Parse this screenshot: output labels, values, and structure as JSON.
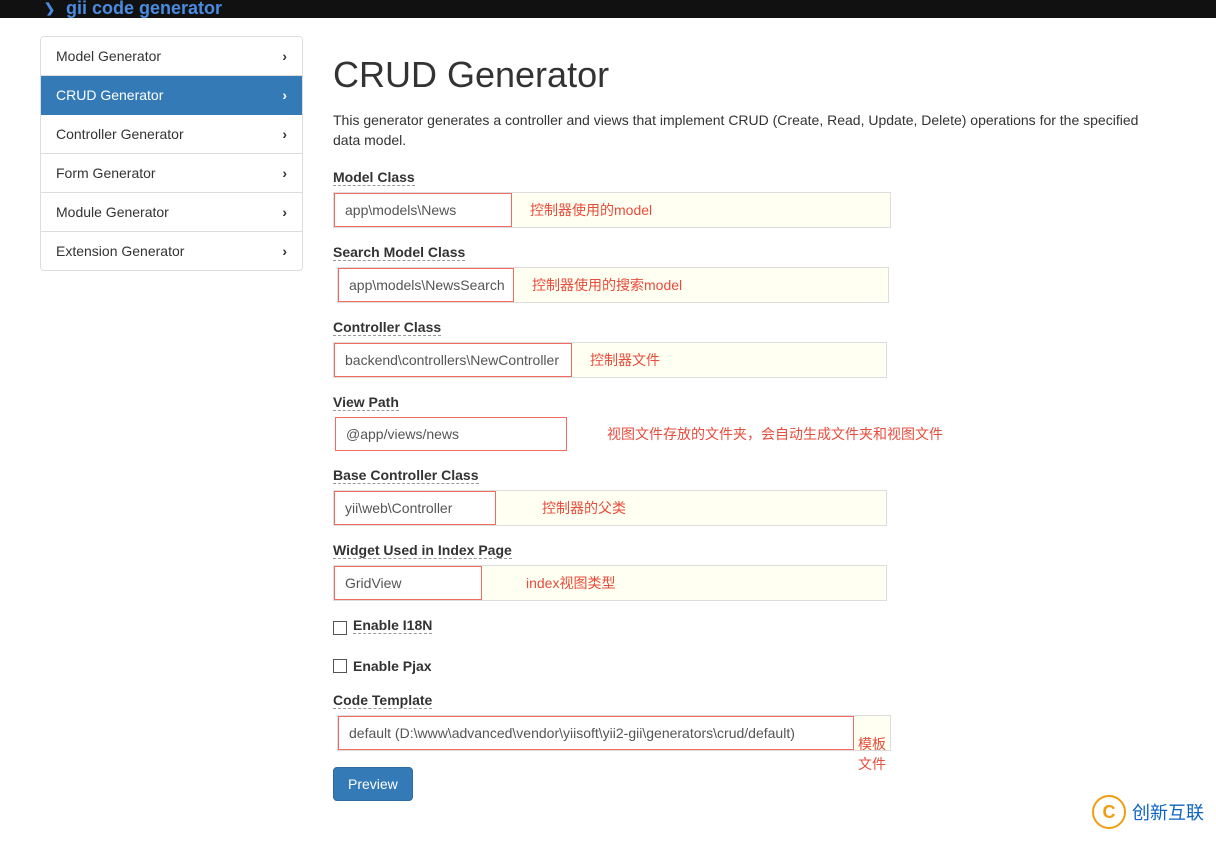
{
  "topbar": {
    "brand": "gii code generator"
  },
  "sidebar": {
    "items": [
      {
        "label": "Model Generator",
        "active": false
      },
      {
        "label": "CRUD Generator",
        "active": true
      },
      {
        "label": "Controller Generator",
        "active": false
      },
      {
        "label": "Form Generator",
        "active": false
      },
      {
        "label": "Module Generator",
        "active": false
      },
      {
        "label": "Extension Generator",
        "active": false
      }
    ]
  },
  "page": {
    "title": "CRUD Generator",
    "description": "This generator generates a controller and views that implement CRUD (Create, Read, Update, Delete) operations for the specified data model."
  },
  "form": {
    "model_class": {
      "label": "Model Class",
      "value": "app\\models\\News",
      "note": "控制器使用的model"
    },
    "search_model_class": {
      "label": "Search Model Class",
      "value": "app\\models\\NewsSearch",
      "note": "控制器使用的搜索model"
    },
    "controller_class": {
      "label": "Controller Class",
      "value": "backend\\controllers\\NewController",
      "note": "控制器文件"
    },
    "view_path": {
      "label": "View Path",
      "value": "@app/views/news",
      "note": "视图文件存放的文件夹，会自动生成文件夹和视图文件"
    },
    "base_controller_class": {
      "label": "Base Controller Class",
      "value": "yii\\web\\Controller",
      "note": "控制器的父类"
    },
    "widget": {
      "label": "Widget Used in Index Page",
      "value": "GridView",
      "note": "index视图类型"
    },
    "enable_i18n": {
      "label": "Enable I18N"
    },
    "enable_pjax": {
      "label": "Enable Pjax"
    },
    "code_template": {
      "label": "Code Template",
      "value": "default (D:\\www\\advanced\\vendor\\yiisoft\\yii2-gii\\generators\\crud/default)",
      "note": "模板文件"
    },
    "preview_button": "Preview"
  },
  "watermark": {
    "icon": "C",
    "text": "创新互联"
  }
}
